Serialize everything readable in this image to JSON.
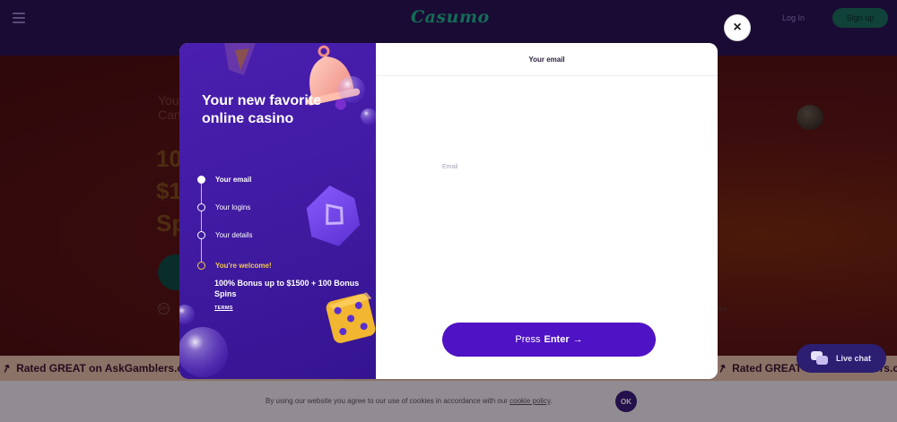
{
  "header": {
    "brand": "Casumo",
    "login_label": "Log In",
    "signup_label": "Sign up"
  },
  "hero": {
    "line1": "You",
    "line2": "Can",
    "big1": "10",
    "big2": "$1",
    "big3": "Sp",
    "age_badge": "19+",
    "terms_fragment": "ms"
  },
  "ticker": {
    "items": [
      "Rated GREAT on AskGamblers.com",
      "Rated GREAT on AskGamblers.com"
    ]
  },
  "live_chat": {
    "label": "Live chat"
  },
  "cookie": {
    "text": "By using our website you agree to our use of cookies in accordance with our ",
    "link": "cookie policy",
    "ok": "OK"
  },
  "modal": {
    "title": "Your new favorite online casino",
    "steps": [
      {
        "label": "Your email",
        "state": "active"
      },
      {
        "label": "Your logins",
        "state": "pending"
      },
      {
        "label": "Your details",
        "state": "pending"
      },
      {
        "label": "You're welcome!",
        "state": "final"
      }
    ],
    "bonus_text": "100% Bonus up to $1500 + 100 Bonus Spins",
    "terms_label": "TERMS",
    "header": "Your email",
    "email_label": "Email",
    "email_value": "                            ",
    "button_prefix": "Press",
    "button_key": "Enter",
    "button_arrow": "→",
    "close_icon": "×"
  },
  "colors": {
    "accent_purple": "#4f12c4",
    "panel_purple": "#3f1aa0",
    "gold": "#f2c94c",
    "brand_green": "#1fae8c"
  }
}
